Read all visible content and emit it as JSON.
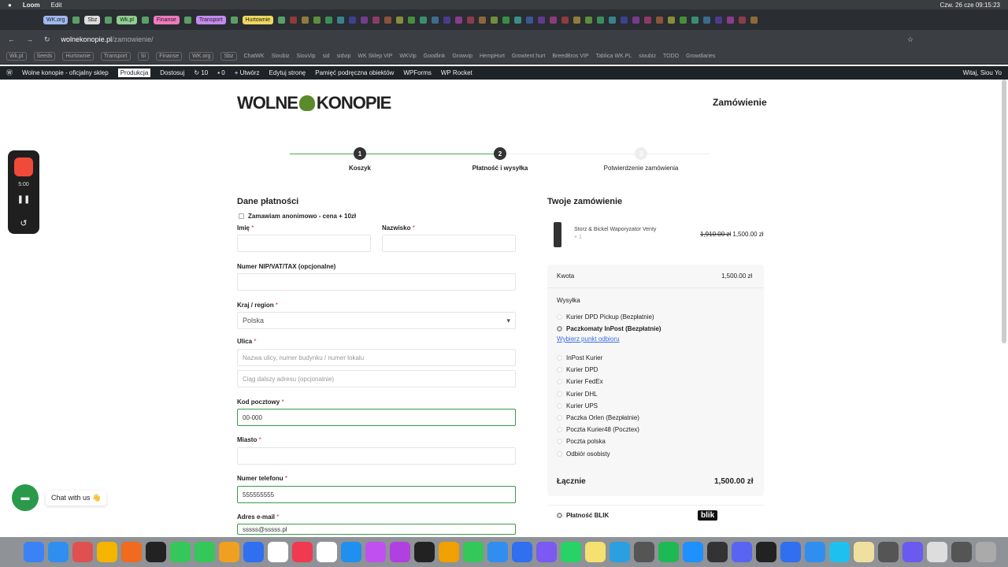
{
  "menubar": {
    "app": "Loom",
    "menu": "Edit",
    "clock": "Czw. 26 cze  09:15:23"
  },
  "tabs": [
    {
      "label": "WK.org",
      "color": "#9fb8f0"
    },
    {
      "label": "Sbz",
      "color": "#ddd"
    },
    {
      "label": "Wk.pl",
      "color": "#8fd08f"
    },
    {
      "label": "Finanse",
      "color": "#f07ac0"
    },
    {
      "label": "Transport",
      "color": "#c58af0"
    },
    {
      "label": "Hurtownie",
      "color": "#f0d860"
    }
  ],
  "address": {
    "domain": "wolnekonopie.pl",
    "path": "/zamowienie/"
  },
  "bookmarks": [
    "Wk.pl",
    "Seeds",
    "Hurtownie",
    "Transport",
    "SI",
    "Finanse",
    "WK.org",
    "Sbz",
    "ChatWK",
    "Sioubiz",
    "SiouVip",
    "sid",
    "sidvip",
    "WK Sklep VIP",
    "WKVip",
    "Goodlink",
    "Growvip",
    "HempHurt",
    "Growtent hurt",
    "BreedBros VIP",
    "Tablica WK.PL",
    "sioubiz",
    "TODO",
    "Growdiaries"
  ],
  "wpbar": {
    "site": "Wolne konopie - oficjalny sklep",
    "env": "Produkcja",
    "customize": "Dostosuj",
    "updates": "10",
    "comments": "0",
    "new": "Utwórz",
    "edit": "Edytuj stronę",
    "cache": "Pamięć podręczna obiektów",
    "wpforms": "WPForms",
    "rocket": "WP Rocket",
    "greeting": "Witaj, Siou Yo"
  },
  "loom": {
    "time": "5:00"
  },
  "logo": "WOLNE KONOPIE",
  "page_title": "Zamówienie",
  "steps": [
    {
      "num": "1",
      "label": "Koszyk"
    },
    {
      "num": "2",
      "label": "Płatność i wysyłka"
    },
    {
      "num": "3",
      "label": "Potwierdzenie zamówienia"
    }
  ],
  "billing": {
    "title": "Dane płatności",
    "anon": "Zamawiam anonimowo - cena + 10zł",
    "first_name": "Imię",
    "last_name": "Nazwisko",
    "nip": "Numer NIP/VAT/TAX (opcjonalne)",
    "country": "Kraj / region",
    "country_value": "Polska",
    "street": "Ulica",
    "street_ph": "Nazwa ulicy, numer budynku / numer lokalu",
    "street2_ph": "Ciąg dalszy adresu (opcjonalnie)",
    "postcode": "Kod pocztowy",
    "postcode_value": "00-000",
    "city": "Miasto",
    "phone": "Numer telefonu",
    "phone_value": "555555555",
    "email": "Adres e-mail",
    "email_value": "sssss@sssss.pl",
    "req": "*"
  },
  "order": {
    "title": "Twoje zamówienie",
    "product": "Storz & Bickel Waporyzator Venty",
    "qty": "× 1",
    "old_price": "1,910.00 zł",
    "price": "1,500.00 zł",
    "subtotal_label": "Kwota",
    "subtotal": "1,500.00 zł",
    "shipping_label": "Wysyłka",
    "shipping": [
      "Kurier DPD Pickup (Bezpłatnie)",
      "Paczkomaty InPost (Bezpłatnie)"
    ],
    "pickup_link": "Wybierz punkt odbioru",
    "shipping_more": [
      "InPost Kurier",
      "Kurier DPD",
      "Kurier FedEx",
      "Kurier DHL",
      "Kurier UPS",
      "Paczka Orlen (Bezpłatnie)",
      "Poczta Kurier48 (Pocztex)",
      "Poczta polska",
      "Odbiór osobisty"
    ],
    "selected_shipping": "Paczkomaty InPost (Bezpłatnie)",
    "total_label": "Łącznie",
    "total": "1,500.00 zł",
    "payment": "Płatność BLIK",
    "blik_logo": "blik"
  },
  "chat": {
    "label": "Chat with us 👋"
  },
  "dock": [
    "#3b82f6",
    "#2f8ef0",
    "#e05050",
    "#f4b400",
    "#f06a20",
    "#222",
    "#34c759",
    "#34c759",
    "#f0a020",
    "#2f6ff0",
    "#fff",
    "#f03a50",
    "#fff",
    "#1f8ff0",
    "#c050f0",
    "#b040e0",
    "#222",
    "#f0a000",
    "#34c759",
    "#2f8ef0",
    "#2f6ff0",
    "#7a5af0",
    "#25d366",
    "#f5e070",
    "#2aa0e0",
    "#555",
    "#1db954",
    "#1e90ff",
    "#333",
    "#5865f2",
    "#222",
    "#2f6ff0",
    "#2f8ef0",
    "#1ec0f0",
    "#f0e0a0",
    "#555",
    "#6a5af0",
    "#ddd",
    "#555",
    "#aaa"
  ]
}
